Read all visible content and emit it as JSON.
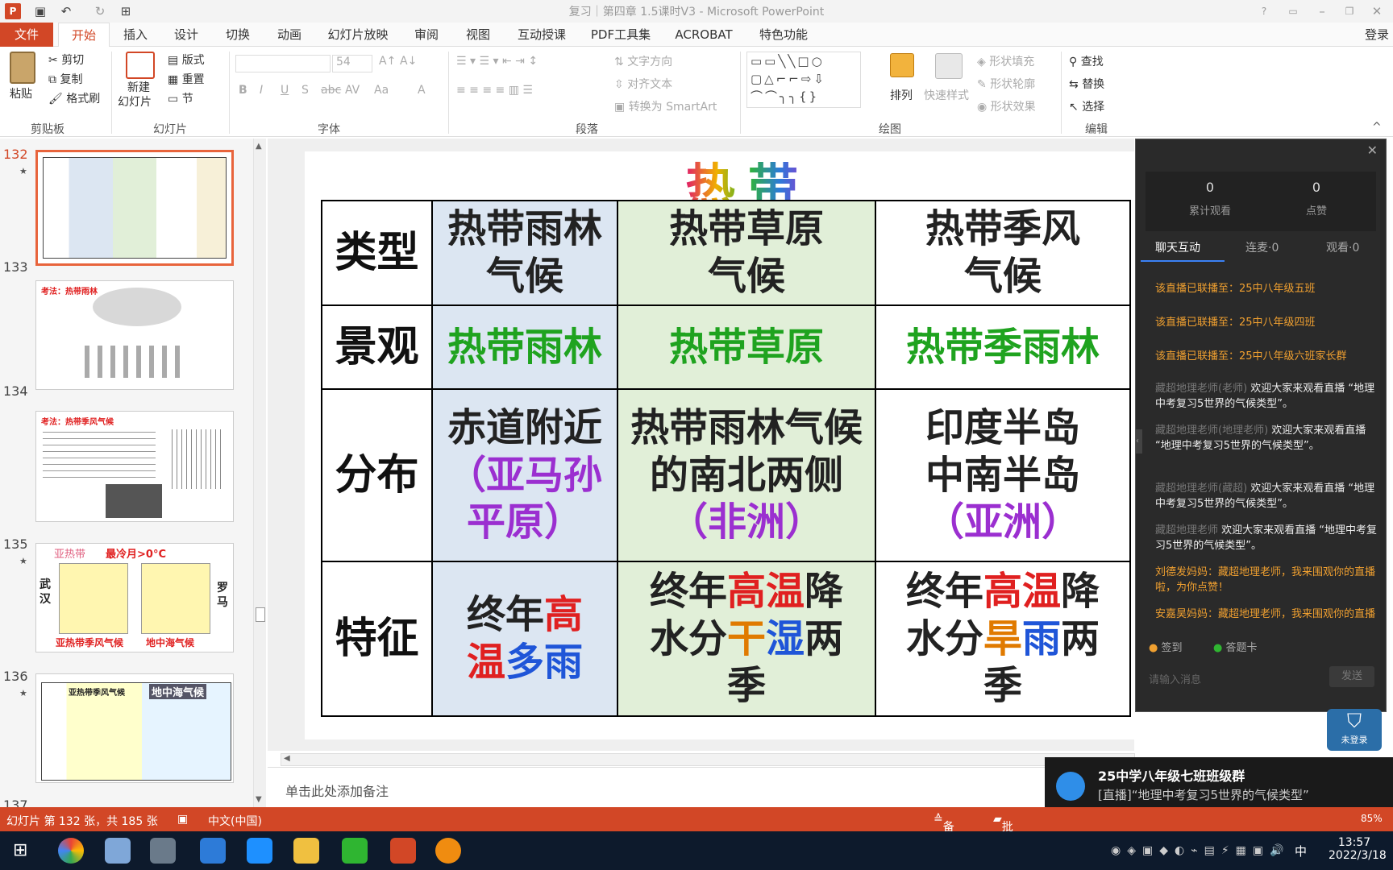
{
  "titlebar": {
    "title": "复习｜第四章 1.5课时V3 - Microsoft PowerPoint"
  },
  "menu": {
    "tabs": [
      "文件",
      "开始",
      "插入",
      "设计",
      "切换",
      "动画",
      "幻灯片放映",
      "审阅",
      "视图",
      "互动授课",
      "PDF工具集",
      "ACROBAT",
      "特色功能"
    ],
    "login": "登录"
  },
  "ribbon": {
    "clipboard": {
      "paste": "粘贴",
      "cut": "剪切",
      "copy": "复制",
      "format": "格式刷",
      "label": "剪贴板"
    },
    "slides": {
      "new": "新建",
      "new2": "幻灯片",
      "layout": "版式",
      "reset": "重置",
      "section": "节",
      "label": "幻灯片"
    },
    "font": {
      "size": "54",
      "label": "字体",
      "bold": "B",
      "italic": "I",
      "underline": "U",
      "shadow": "S",
      "strike": "abc",
      "spacing": "AV",
      "case": "Aa",
      "color": "A"
    },
    "paragraph": {
      "direction": "文字方向",
      "align": "对齐文本",
      "smartart": "转换为 SmartArt",
      "label": "段落"
    },
    "drawing": {
      "arrange": "排列",
      "quick": "快速样式",
      "fill": "形状填充",
      "outline": "形状轮廓",
      "effect": "形状效果",
      "label": "绘图"
    },
    "edit": {
      "find": "查找",
      "replace": "替换",
      "select": "选择",
      "label": "编辑"
    }
  },
  "thumbs": [
    {
      "num": "132",
      "star": "★"
    },
    {
      "num": "133",
      "star": ""
    },
    {
      "num": "134",
      "star": ""
    },
    {
      "num": "135",
      "star": "★"
    },
    {
      "num": "136",
      "star": "★"
    },
    {
      "num": "137",
      "star": ""
    }
  ],
  "thumb_text": {
    "t133": "考法：热带雨林",
    "t134": "考法：热带季风气候",
    "t135a": "亚热带",
    "t135b": "最冷月>0°C",
    "t135c": "武汉",
    "t135d": "罗马",
    "t135e": "亚热带季风气候",
    "t135f": "地中海气候",
    "t136a": "亚热带季风气候",
    "t136b": "地中海气候"
  },
  "slide": {
    "title": "热带",
    "row_headers": [
      "类型",
      "景观",
      "分布",
      "特征"
    ],
    "types": [
      "热带雨林气候",
      "热带草原气候",
      "热带季风气候"
    ],
    "landscapes": [
      "热带雨林",
      "热带草原",
      "热带季雨林"
    ],
    "dist": {
      "c1a": "赤道附近",
      "c1b": "（亚马孙平原）",
      "c2a": "热带雨林气候的南北两侧",
      "c2b": "（非洲）",
      "c3a": "印度半岛",
      "c3b": "中南半岛",
      "c3c": "（亚洲）"
    },
    "feat": {
      "c1a": "终年",
      "c1b": "高温",
      "c1c": "多雨",
      "c2a": "终年",
      "c2b": "高温",
      "c2c": "降水分",
      "c2d": "干",
      "c2e": "湿",
      "c2f": "两季",
      "c3a": "终年",
      "c3b": "高温",
      "c3c": "降水分",
      "c3d": "旱",
      "c3e": "雨",
      "c3f": "两季"
    }
  },
  "notes": "单击此处添加备注",
  "status": {
    "slide": "幻灯片 第 132 张，共 185 张",
    "lang": "中文(中国)",
    "notes": "备注",
    "comments": "批注",
    "zoom": "85%"
  },
  "panel": {
    "viewers": "0",
    "viewers_label": "累计观看",
    "likes": "0",
    "likes_label": "点赞",
    "tabs": [
      "聊天互动",
      "连麦·0",
      "观看·0"
    ],
    "messages": [
      {
        "type": "sys",
        "text": "该直播已联播至：25中八年级五班"
      },
      {
        "type": "sys",
        "text": "该直播已联播至：25中八年级四班"
      },
      {
        "type": "sys",
        "text": "该直播已联播至：25中八年级六班家长群"
      },
      {
        "type": "chat",
        "who": "藏超地理老师(老师)",
        "text": "欢迎大家来观看直播 “地理中考复习5世界的气候类型”。"
      },
      {
        "type": "chat",
        "who": "藏超地理老师(地理老师)",
        "text": "欢迎大家来观看直播 “地理中考复习5世界的气候类型”。"
      },
      {
        "type": "chat",
        "who": "藏超地理老师(藏超)",
        "text": "欢迎大家来观看直播 “地理中考复习5世界的气候类型”。"
      },
      {
        "type": "chat",
        "who": "藏超地理老师",
        "text": "欢迎大家来观看直播 “地理中考复习5世界的气候类型”。"
      },
      {
        "type": "gift",
        "text": "刘德发妈妈：藏超地理老师，我来围观你的直播啦，为你点赞！"
      },
      {
        "type": "gift",
        "text": "安嘉昊妈妈：藏超地理老师，我来围观你的直播啦，为你点赞！"
      }
    ],
    "signin": "签到",
    "answer": "答题卡",
    "input_placeholder": "请输入消息",
    "send": "发送",
    "nologin": "未登录"
  },
  "toast": {
    "title": "25中学八年级七班班级群",
    "msg": "[直播]“地理中考复习5世界的气候类型”"
  },
  "clock": {
    "time": "13:57",
    "date": "2022/3/18",
    "ime": "中"
  },
  "colors": {
    "accent": "#d24726",
    "panel_bg": "#2a2a2a",
    "sys_msg": "#f0a030"
  }
}
